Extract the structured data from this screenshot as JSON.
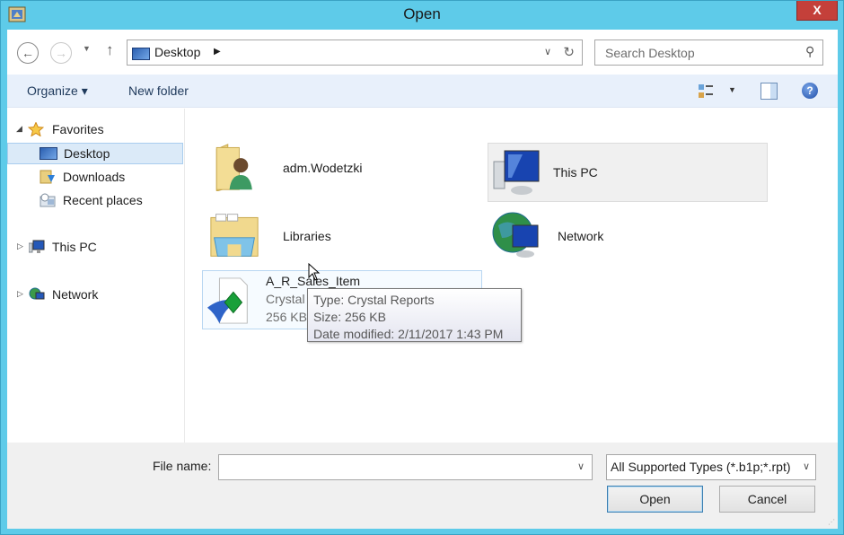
{
  "window": {
    "title": "Open",
    "close_label": "X",
    "colors": {
      "frame": "#5ecbe9",
      "close": "#c4403a",
      "selection": "#dbeaf8"
    }
  },
  "address_bar": {
    "back_icon": "back-arrow-icon",
    "forward_icon": "forward-arrow-icon",
    "up_icon": "up-arrow-icon",
    "path": [
      "Desktop"
    ],
    "search_placeholder": "Search Desktop"
  },
  "toolbar": {
    "organize_label": "Organize ▾",
    "new_folder_label": "New folder",
    "view_icon": "change-view-icon",
    "preview_pane_icon": "preview-pane-icon",
    "help_icon": "help-icon"
  },
  "nav_pane": {
    "items": [
      {
        "label": "Favorites",
        "icon": "star-icon",
        "expander": "◢",
        "level": 0
      },
      {
        "label": "Desktop",
        "icon": "desktop-icon",
        "level": 1,
        "selected": true
      },
      {
        "label": "Downloads",
        "icon": "downloads-icon",
        "level": 1
      },
      {
        "label": "Recent places",
        "icon": "recent-places-icon",
        "level": 1
      },
      {
        "label": "This PC",
        "icon": "computer-icon",
        "expander": "▷",
        "level": 0
      },
      {
        "label": "Network",
        "icon": "network-icon",
        "expander": "▷",
        "level": 0
      }
    ]
  },
  "content": {
    "items": [
      {
        "name": "adm.Wodetzki",
        "icon": "user-folder-icon"
      },
      {
        "name": "This PC",
        "icon": "computer-icon"
      },
      {
        "name": "Libraries",
        "icon": "libraries-icon"
      },
      {
        "name": "Network",
        "icon": "network-icon"
      },
      {
        "name": "A_R_Sales_Item",
        "type": "Crystal Reports",
        "size": "256 KB",
        "icon": "crystal-reports-file-icon"
      }
    ],
    "tooltip": {
      "type": "Type: Crystal Reports",
      "size": "Size: 256 KB",
      "date": "Date modified: 2/11/2017 1:43 PM"
    }
  },
  "footer": {
    "file_name_label": "File name:",
    "file_name_value": "",
    "file_type_value": "All Supported Types (*.b1p;*.rpt)",
    "open_label": "Open",
    "cancel_label": "Cancel"
  }
}
